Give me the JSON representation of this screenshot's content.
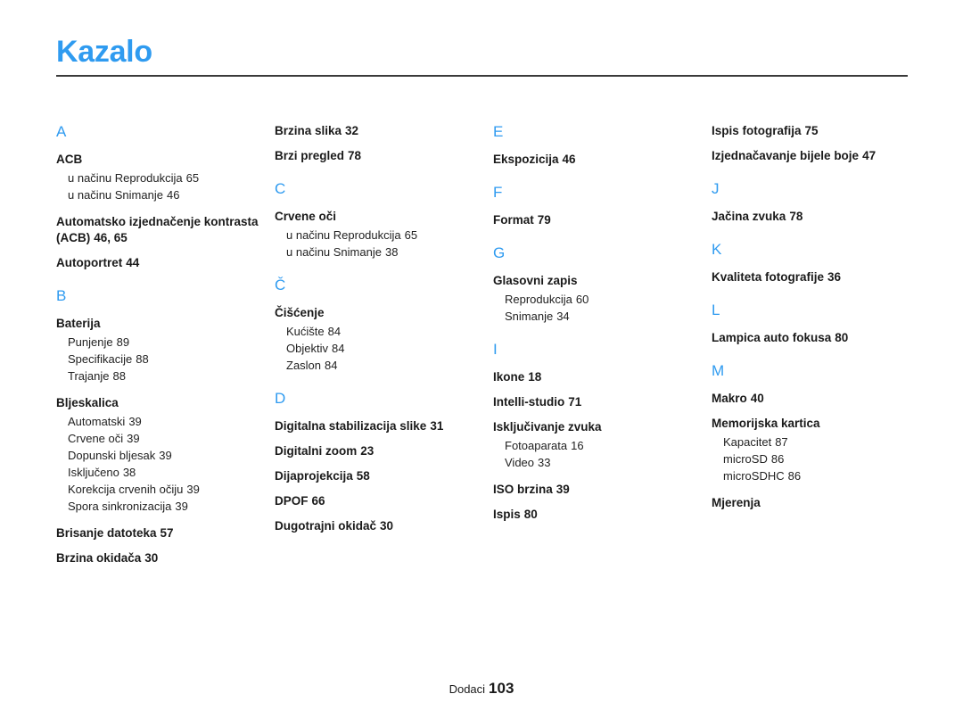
{
  "document": {
    "title": "Kazalo",
    "accent_color": "#2f9bf0",
    "text_color": "#1a1a1a"
  },
  "footer": {
    "label": "Dodaci",
    "page_number": "103"
  },
  "columns": [
    {
      "groups": [
        {
          "letter": "A",
          "entries": [
            {
              "term": "ACB",
              "pages": "",
              "subs": [
                {
                  "label": "u načinu Reprodukcija",
                  "pages": "65"
                },
                {
                  "label": "u načinu Snimanje",
                  "pages": "46"
                }
              ]
            },
            {
              "term": "Automatsko izjednačenje kontrasta (ACB)",
              "pages": "46, 65",
              "subs": []
            },
            {
              "term": "Autoportret",
              "pages": "44",
              "subs": []
            }
          ]
        },
        {
          "letter": "B",
          "entries": [
            {
              "term": "Baterija",
              "pages": "",
              "subs": [
                {
                  "label": "Punjenje",
                  "pages": "89"
                },
                {
                  "label": "Specifikacije",
                  "pages": "88"
                },
                {
                  "label": "Trajanje",
                  "pages": "88"
                }
              ]
            },
            {
              "term": "Bljeskalica",
              "pages": "",
              "subs": [
                {
                  "label": "Automatski",
                  "pages": "39"
                },
                {
                  "label": "Crvene oči",
                  "pages": "39"
                },
                {
                  "label": "Dopunski bljesak",
                  "pages": "39"
                },
                {
                  "label": "Isključeno",
                  "pages": "38"
                },
                {
                  "label": "Korekcija crvenih očiju",
                  "pages": "39"
                },
                {
                  "label": "Spora sinkronizacija",
                  "pages": "39"
                }
              ]
            },
            {
              "term": "Brisanje datoteka",
              "pages": "57",
              "subs": []
            },
            {
              "term": "Brzina okidača",
              "pages": "30",
              "subs": []
            }
          ]
        }
      ]
    },
    {
      "groups": [
        {
          "letter": "",
          "entries": [
            {
              "term": "Brzina slika",
              "pages": "32",
              "subs": []
            },
            {
              "term": "Brzi pregled",
              "pages": "78",
              "subs": []
            }
          ]
        },
        {
          "letter": "C",
          "entries": [
            {
              "term": "Crvene oči",
              "pages": "",
              "subs": [
                {
                  "label": "u načinu Reprodukcija",
                  "pages": "65"
                },
                {
                  "label": "u načinu Snimanje",
                  "pages": "38"
                }
              ]
            }
          ]
        },
        {
          "letter": "Č",
          "entries": [
            {
              "term": "Čišćenje",
              "pages": "",
              "subs": [
                {
                  "label": "Kućište",
                  "pages": "84"
                },
                {
                  "label": "Objektiv",
                  "pages": "84"
                },
                {
                  "label": "Zaslon",
                  "pages": "84"
                }
              ]
            }
          ]
        },
        {
          "letter": "D",
          "entries": [
            {
              "term": "Digitalna stabilizacija slike",
              "pages": "31",
              "subs": []
            },
            {
              "term": "Digitalni zoom",
              "pages": "23",
              "subs": []
            },
            {
              "term": "Dijaprojekcija",
              "pages": "58",
              "subs": []
            },
            {
              "term": "DPOF",
              "pages": "66",
              "subs": []
            },
            {
              "term": "Dugotrajni okidač",
              "pages": "30",
              "subs": []
            }
          ]
        }
      ]
    },
    {
      "groups": [
        {
          "letter": "E",
          "entries": [
            {
              "term": "Ekspozicija",
              "pages": "46",
              "subs": []
            }
          ]
        },
        {
          "letter": "F",
          "entries": [
            {
              "term": "Format",
              "pages": "79",
              "subs": []
            }
          ]
        },
        {
          "letter": "G",
          "entries": [
            {
              "term": "Glasovni zapis",
              "pages": "",
              "subs": [
                {
                  "label": "Reprodukcija",
                  "pages": "60"
                },
                {
                  "label": "Snimanje",
                  "pages": "34"
                }
              ]
            }
          ]
        },
        {
          "letter": "I",
          "entries": [
            {
              "term": "Ikone",
              "pages": "18",
              "subs": []
            },
            {
              "term": "Intelli-studio",
              "pages": "71",
              "subs": []
            },
            {
              "term": "Isključivanje zvuka",
              "pages": "",
              "subs": [
                {
                  "label": "Fotoaparata",
                  "pages": "16"
                },
                {
                  "label": "Video",
                  "pages": "33"
                }
              ]
            },
            {
              "term": "ISO brzina",
              "pages": "39",
              "subs": []
            },
            {
              "term": "Ispis",
              "pages": "80",
              "subs": []
            }
          ]
        }
      ]
    },
    {
      "groups": [
        {
          "letter": "",
          "entries": [
            {
              "term": "Ispis fotografija",
              "pages": "75",
              "subs": []
            },
            {
              "term": "Izjednačavanje bijele boje",
              "pages": "47",
              "subs": []
            }
          ]
        },
        {
          "letter": "J",
          "entries": [
            {
              "term": "Jačina zvuka",
              "pages": "78",
              "subs": []
            }
          ]
        },
        {
          "letter": "K",
          "entries": [
            {
              "term": "Kvaliteta fotografije",
              "pages": "36",
              "subs": []
            }
          ]
        },
        {
          "letter": "L",
          "entries": [
            {
              "term": "Lampica auto fokusa",
              "pages": "80",
              "subs": []
            }
          ]
        },
        {
          "letter": "M",
          "entries": [
            {
              "term": "Makro",
              "pages": "40",
              "subs": []
            },
            {
              "term": "Memorijska kartica",
              "pages": "",
              "subs": [
                {
                  "label": "Kapacitet",
                  "pages": "87"
                },
                {
                  "label": "microSD",
                  "pages": "86"
                },
                {
                  "label": "microSDHC",
                  "pages": "86"
                }
              ]
            },
            {
              "term": "Mjerenja",
              "pages": "",
              "subs": []
            }
          ]
        }
      ]
    }
  ]
}
